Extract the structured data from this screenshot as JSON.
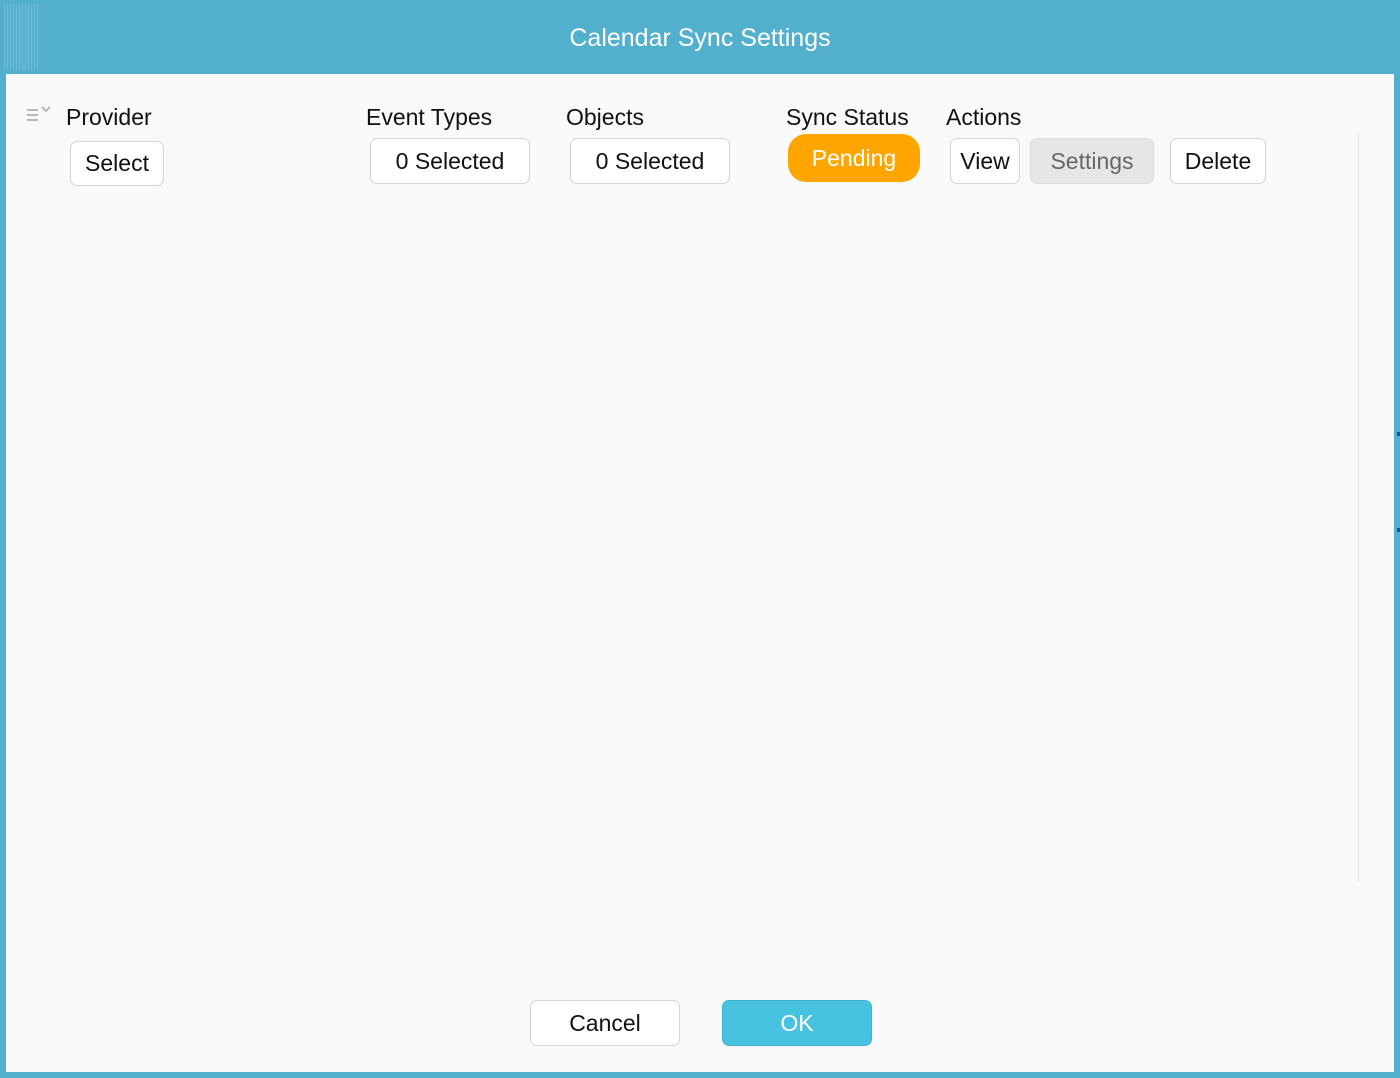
{
  "window": {
    "title": "Calendar Sync Settings"
  },
  "columns": {
    "provider": "Provider",
    "event_types": "Event Types",
    "objects": "Objects",
    "sync_status": "Sync Status",
    "actions": "Actions"
  },
  "row": {
    "provider_value": "Select",
    "event_types_value": "0 Selected",
    "objects_value": "0 Selected",
    "sync_status": "Pending",
    "sync_status_color": "#ffa500",
    "actions": {
      "view": "View",
      "settings": "Settings",
      "delete": "Delete"
    }
  },
  "footer": {
    "cancel": "Cancel",
    "ok": "OK"
  },
  "colors": {
    "titlebar": "#52afcd",
    "primary_button": "#47c2e0",
    "background": "#f9f9f9"
  },
  "icons": {
    "column_menu": "list-chevron-icon"
  }
}
